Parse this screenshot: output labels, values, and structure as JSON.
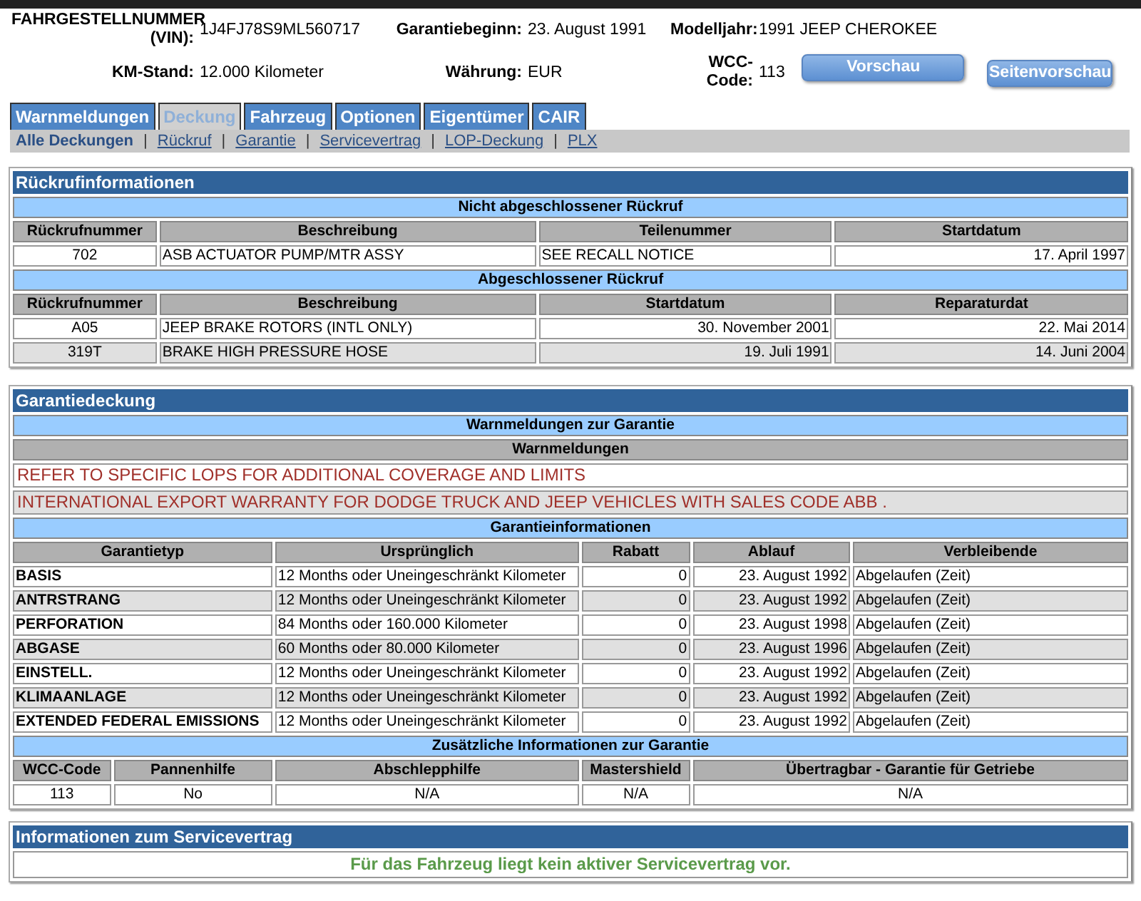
{
  "header": {
    "fields": [
      {
        "label": "FAHRGESTELLNUMMER (VIN):",
        "value": "1J4FJ78S9ML560717"
      },
      {
        "label": "Garantiebeginn:",
        "value": "23. August 1991"
      },
      {
        "label": "Modelljahr:",
        "value": "1991 JEEP CHEROKEE"
      },
      {
        "label": "KM-Stand:",
        "value": "12.000  Kilometer"
      },
      {
        "label": "Währung:",
        "value": "EUR"
      },
      {
        "label": "WCC-Code:",
        "value": "113"
      }
    ],
    "buttons": [
      "Vorschau",
      "Seitenvorschau"
    ]
  },
  "tabs": [
    {
      "label": "Warnmeldungen",
      "selected": false
    },
    {
      "label": "Deckung",
      "selected": true
    },
    {
      "label": "Fahrzeug",
      "selected": false
    },
    {
      "label": "Optionen",
      "selected": false
    },
    {
      "label": "Eigentümer",
      "selected": false
    },
    {
      "label": "CAIR",
      "selected": false
    }
  ],
  "subnav_separator": "|",
  "subnav": [
    {
      "label": "Alle Deckungen",
      "selected": true
    },
    {
      "label": "Rückruf",
      "selected": false
    },
    {
      "label": "Garantie",
      "selected": false
    },
    {
      "label": "Servicevertrag",
      "selected": false
    },
    {
      "label": "LOP-Deckung",
      "selected": false
    },
    {
      "label": "PLX",
      "selected": false
    }
  ],
  "recall": {
    "title": "Rückrufinformationen",
    "open": {
      "title": "Nicht abgeschlossener Rückruf",
      "columns": [
        "Rückrufnummer",
        "Beschreibung",
        "Teilenummer",
        "Startdatum"
      ],
      "rows": [
        [
          "702",
          "ASB ACTUATOR PUMP/MTR ASSY",
          "SEE RECALL NOTICE",
          "17. April 1997"
        ]
      ]
    },
    "closed": {
      "title": "Abgeschlossener Rückruf",
      "columns": [
        "Rückrufnummer",
        "Beschreibung",
        "Startdatum",
        "Reparaturdat"
      ],
      "rows": [
        [
          "A05",
          "JEEP BRAKE ROTORS (INTL ONLY)",
          "30. November 2001",
          "22. Mai 2014"
        ],
        [
          "319T",
          "BRAKE HIGH PRESSURE HOSE",
          "19. Juli 1991",
          "14. Juni 2004"
        ]
      ]
    }
  },
  "warranty": {
    "title": "Garantiedeckung",
    "alerts_title": "Warnmeldungen zur Garantie",
    "alerts_heading": "Warnmeldungen",
    "alerts": [
      "REFER TO SPECIFIC LOPS FOR ADDITIONAL COVERAGE AND LIMITS",
      "INTERNATIONAL EXPORT WARRANTY FOR DODGE TRUCK AND JEEP VEHICLES WITH SALES CODE ABB ."
    ],
    "info": {
      "title": "Garantieinformationen",
      "columns": [
        "Garantietyp",
        "Ursprünglich",
        "Rabatt",
        "Ablauf",
        "Verbleibende"
      ],
      "rows": [
        [
          "BASIS",
          "12 Months oder Uneingeschränkt Kilometer",
          "0",
          "23. August 1992",
          "Abgelaufen (Zeit)"
        ],
        [
          "ANTRSTRANG",
          "12 Months oder Uneingeschränkt Kilometer",
          "0",
          "23. August 1992",
          "Abgelaufen (Zeit)"
        ],
        [
          "PERFORATION",
          "84 Months oder 160.000 Kilometer",
          "0",
          "23. August 1998",
          "Abgelaufen (Zeit)"
        ],
        [
          "ABGASE",
          "60 Months oder 80.000 Kilometer",
          "0",
          "23. August 1996",
          "Abgelaufen (Zeit)"
        ],
        [
          "EINSTELL.",
          "12 Months oder Uneingeschränkt Kilometer",
          "0",
          "23. August 1992",
          "Abgelaufen (Zeit)"
        ],
        [
          "KLIMAANLAGE",
          "12 Months oder Uneingeschränkt Kilometer",
          "0",
          "23. August 1992",
          "Abgelaufen (Zeit)"
        ],
        [
          "EXTENDED FEDERAL EMISSIONS",
          "12 Months oder Uneingeschränkt Kilometer",
          "0",
          "23. August 1992",
          "Abgelaufen (Zeit)"
        ]
      ]
    },
    "extra": {
      "title": "Zusätzliche Informationen zur Garantie",
      "columns": [
        "WCC-Code",
        "Pannenhilfe",
        "Abschlepphilfe",
        "Mastershield",
        "Übertragbar - Garantie für Getriebe"
      ],
      "rows": [
        [
          "113",
          "No",
          "N/A",
          "N/A",
          "N/A"
        ]
      ]
    }
  },
  "service": {
    "title": "Informationen zum Servicevertrag",
    "message": "Für das Fahrzeug liegt kein aktiver Servicevertrag vor."
  }
}
